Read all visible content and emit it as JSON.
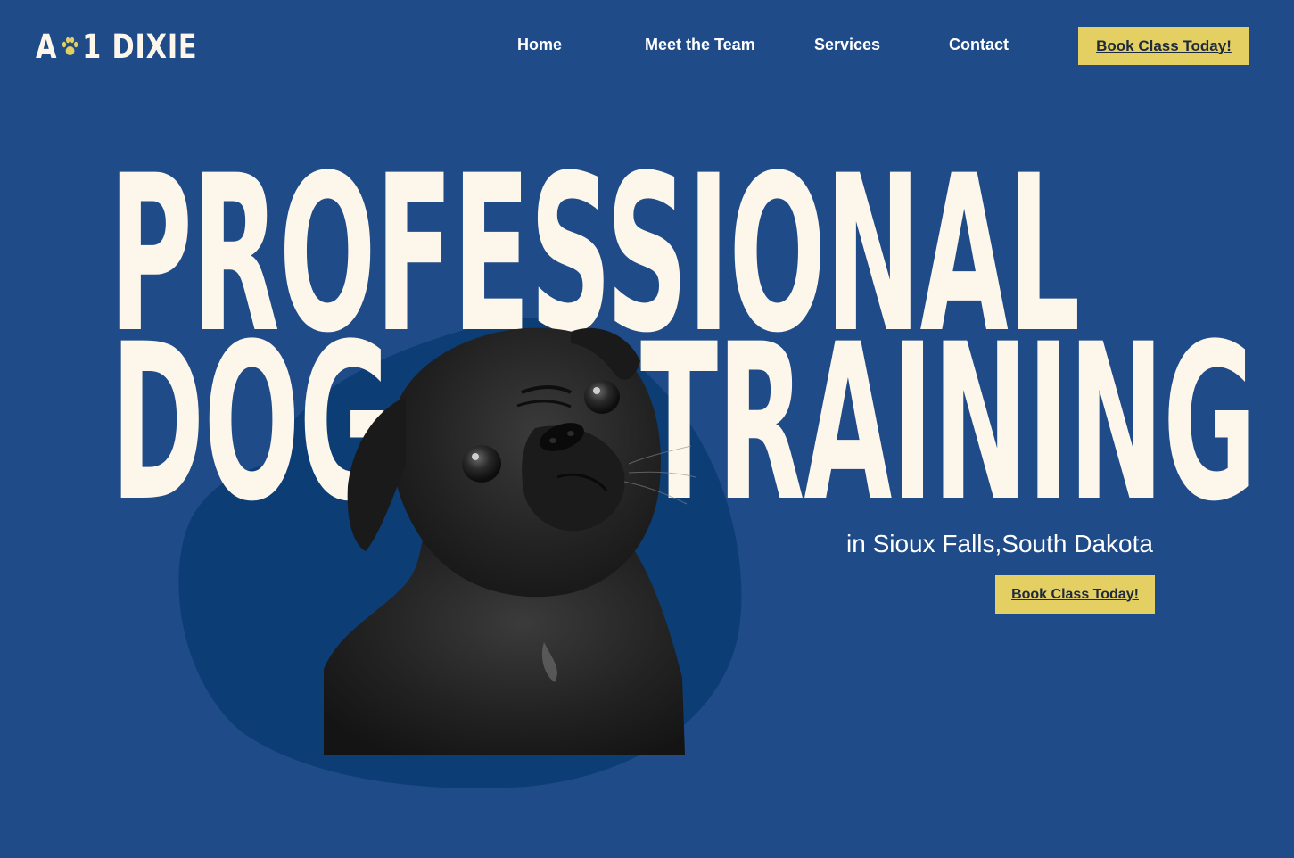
{
  "brand": {
    "logo_left": "A",
    "logo_right": "1 DIXIE",
    "paw_icon": "paw-icon",
    "paw_color": "#e3cf62"
  },
  "nav": {
    "items": [
      {
        "label": "Home"
      },
      {
        "label": "Meet the Team"
      },
      {
        "label": "Services"
      },
      {
        "label": "Contact"
      }
    ],
    "cta_label": "Book Class Today!"
  },
  "hero": {
    "line1": "PROFESSIONAL",
    "line2_left": "DOG",
    "line2_right": "TRAINING",
    "subtitle": "in Sioux Falls,South Dakota",
    "cta_label": "Book Class Today!",
    "image": "black pug looking up"
  },
  "colors": {
    "background": "#1f4b88",
    "blob": "#0c3d74",
    "headline": "#fdf6ea",
    "button": "#e3cf62",
    "button_text": "#1e2a3c"
  }
}
